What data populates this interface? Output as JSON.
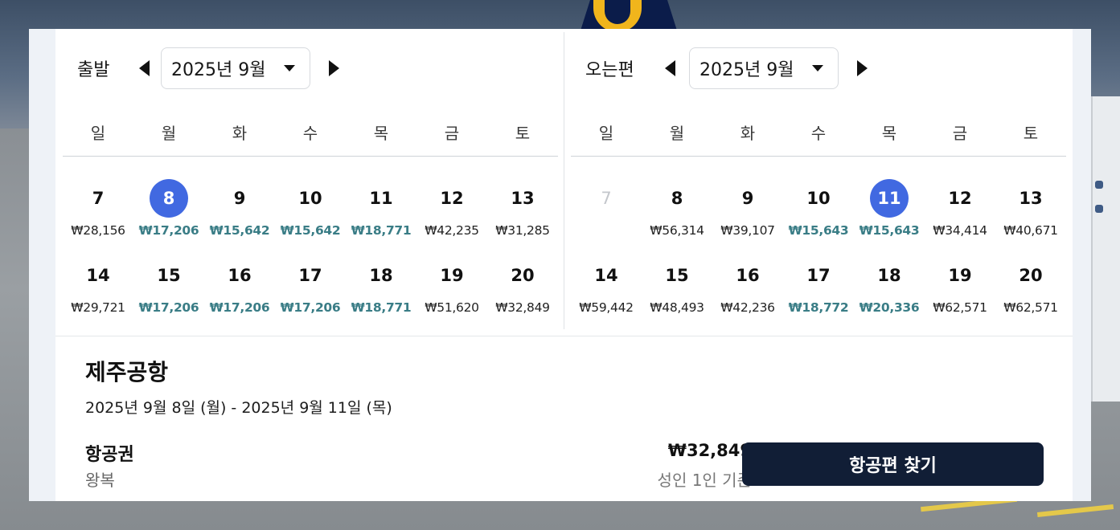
{
  "colors": {
    "selected": "#4169e1",
    "cheap_price": "#3a7d86",
    "primary_button": "#111e36"
  },
  "weekdays": [
    "일",
    "월",
    "화",
    "수",
    "목",
    "금",
    "토"
  ],
  "departure": {
    "label": "출발",
    "month": "2025년 9월",
    "weeks": [
      [
        {
          "day": "7",
          "price": "₩28,156"
        },
        {
          "day": "8",
          "price": "₩17,206",
          "cheap": true,
          "selected": true
        },
        {
          "day": "9",
          "price": "₩15,642",
          "cheap": true
        },
        {
          "day": "10",
          "price": "₩15,642",
          "cheap": true
        },
        {
          "day": "11",
          "price": "₩18,771",
          "cheap": true
        },
        {
          "day": "12",
          "price": "₩42,235"
        },
        {
          "day": "13",
          "price": "₩31,285"
        }
      ],
      [
        {
          "day": "14",
          "price": "₩29,721"
        },
        {
          "day": "15",
          "price": "₩17,206",
          "cheap": true
        },
        {
          "day": "16",
          "price": "₩17,206",
          "cheap": true
        },
        {
          "day": "17",
          "price": "₩17,206",
          "cheap": true
        },
        {
          "day": "18",
          "price": "₩18,771",
          "cheap": true
        },
        {
          "day": "19",
          "price": "₩51,620"
        },
        {
          "day": "20",
          "price": "₩32,849"
        }
      ]
    ]
  },
  "return": {
    "label": "오는편",
    "month": "2025년 9월",
    "weeks": [
      [
        {
          "day": "7",
          "price": "",
          "disabled": true
        },
        {
          "day": "8",
          "price": "₩56,314"
        },
        {
          "day": "9",
          "price": "₩39,107"
        },
        {
          "day": "10",
          "price": "₩15,643",
          "cheap": true
        },
        {
          "day": "11",
          "price": "₩15,643",
          "cheap": true,
          "selected": true
        },
        {
          "day": "12",
          "price": "₩34,414"
        },
        {
          "day": "13",
          "price": "₩40,671"
        }
      ],
      [
        {
          "day": "14",
          "price": "₩59,442"
        },
        {
          "day": "15",
          "price": "₩48,493"
        },
        {
          "day": "16",
          "price": "₩42,236"
        },
        {
          "day": "17",
          "price": "₩18,772",
          "cheap": true
        },
        {
          "day": "18",
          "price": "₩20,336",
          "cheap": true
        },
        {
          "day": "19",
          "price": "₩62,571"
        },
        {
          "day": "20",
          "price": "₩62,571"
        }
      ]
    ]
  },
  "summary": {
    "destination": "제주공항",
    "dates": "2025년 9월 8일 (월) - 2025년 9월 11일 (목)",
    "fare_label": "항공권",
    "fare_type": "왕복",
    "price": "₩32,849",
    "price_note": "성인 1인 기준",
    "search_button": "항공편 찾기"
  }
}
